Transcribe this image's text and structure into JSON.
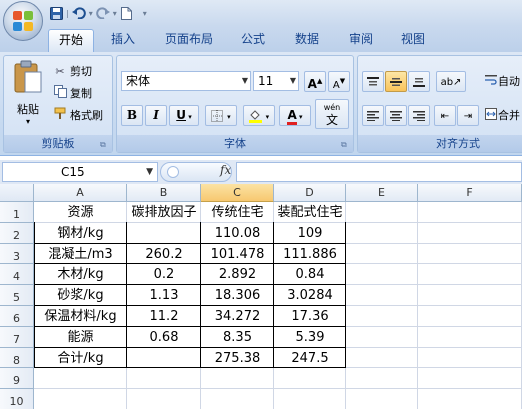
{
  "quick_access": {
    "save_icon": "save-icon",
    "undo_icon": "undo-icon",
    "redo_icon": "redo-icon",
    "new_icon": "new-document-icon"
  },
  "tabs": [
    "开始",
    "插入",
    "页面布局",
    "公式",
    "数据",
    "审阅",
    "视图"
  ],
  "ribbon": {
    "clipboard": {
      "paste": "粘贴",
      "cut": "剪切",
      "copy": "复制",
      "format_painter": "格式刷",
      "label": "剪贴板"
    },
    "font": {
      "font_name": "宋体",
      "font_size": "11",
      "grow": "A",
      "shrink": "A",
      "bold": "B",
      "italic": "I",
      "underline": "U",
      "font_color_glyph": "A",
      "phonetic": "wén",
      "phonetic_char": "文",
      "label": "字体"
    },
    "alignment": {
      "wrap": "自动",
      "merge": "合并",
      "label": "对齐方式"
    }
  },
  "formula_bar": {
    "name_box": "C15",
    "fx": "fx",
    "formula": ""
  },
  "sheet": {
    "columns": [
      "A",
      "B",
      "C",
      "D",
      "E",
      "F"
    ],
    "selected_column": "C",
    "rows": [
      "1",
      "2",
      "3",
      "4",
      "5",
      "6",
      "7",
      "8",
      "9",
      "10"
    ],
    "cells": [
      [
        "资源",
        "碳排放因子",
        "传统住宅",
        "装配式住宅"
      ],
      [
        "钢材/kg",
        "",
        "110.08",
        "109"
      ],
      [
        "混凝土/m3",
        "260.2",
        "101.478",
        "111.886"
      ],
      [
        "木材/kg",
        "0.2",
        "2.892",
        "0.84"
      ],
      [
        "砂浆/kg",
        "1.13",
        "18.306",
        "3.0284"
      ],
      [
        "保温材料/kg",
        "11.2",
        "34.272",
        "17.36"
      ],
      [
        "能源",
        "0.68",
        "8.35",
        "5.39"
      ],
      [
        "合计/kg",
        "",
        "275.38",
        "247.5"
      ]
    ]
  }
}
